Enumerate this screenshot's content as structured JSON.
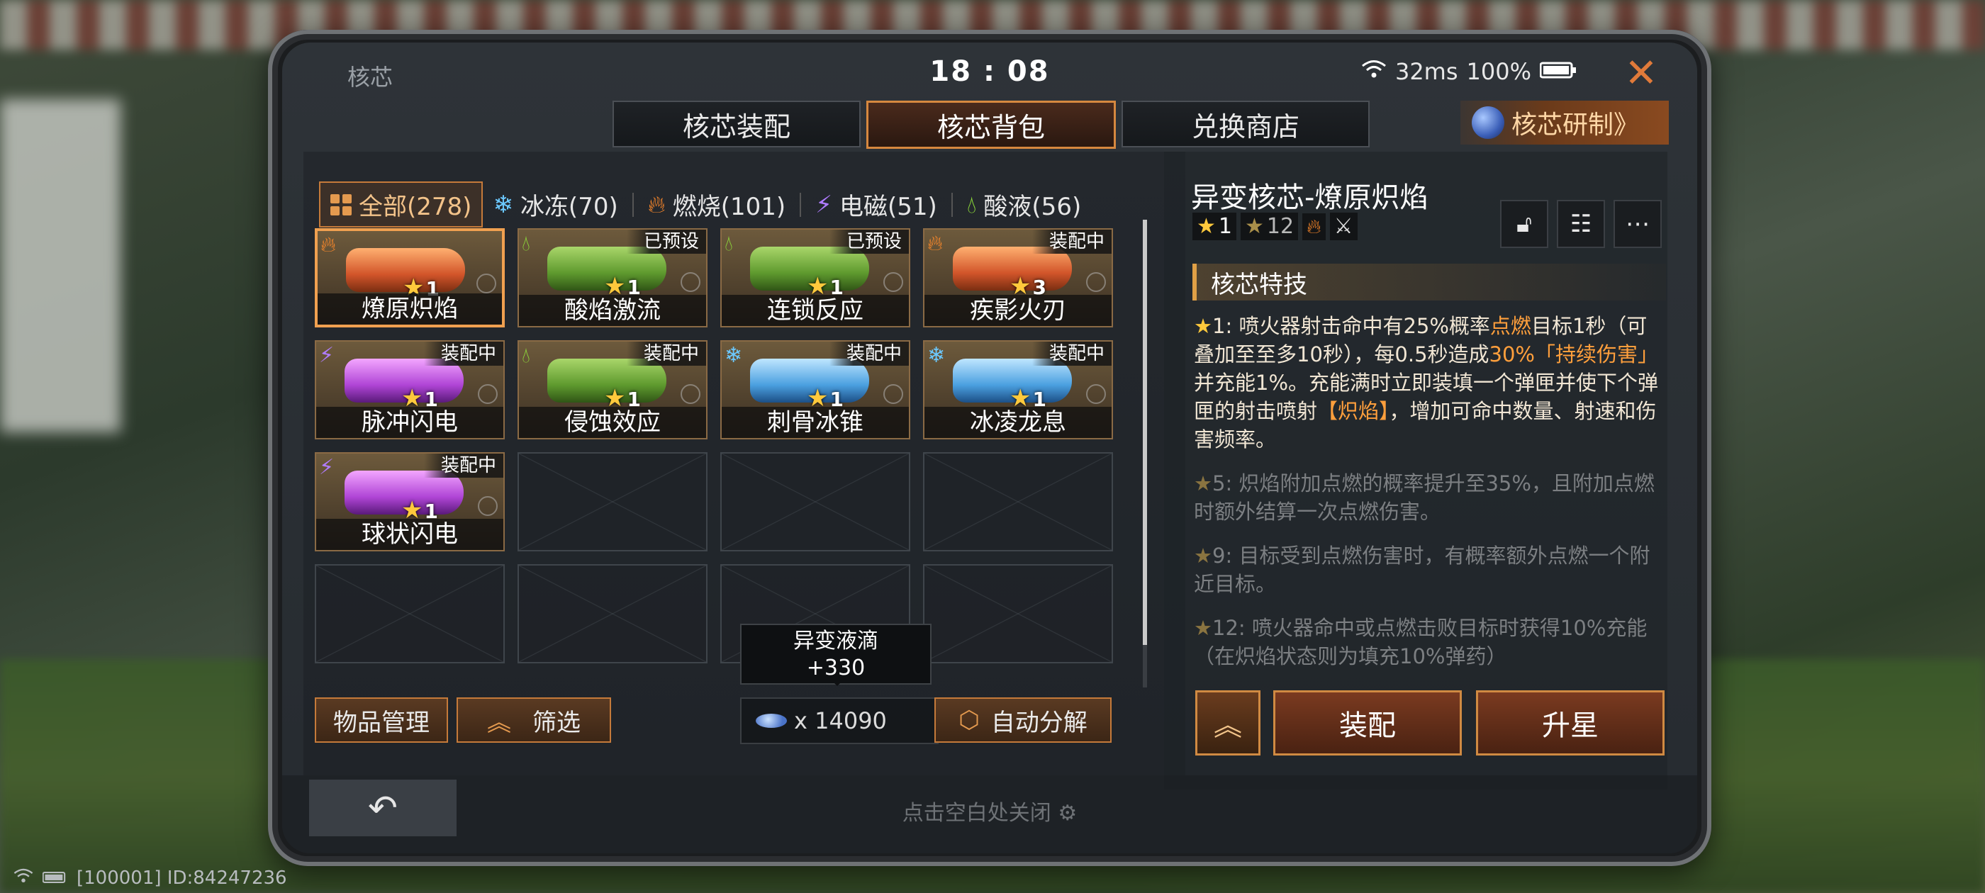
{
  "header": {
    "title": "核芯",
    "time": "18 : 08",
    "latency": "32ms",
    "battery": "100%"
  },
  "tabs": [
    {
      "label": "核芯装配",
      "active": false
    },
    {
      "label": "核芯背包",
      "active": true
    },
    {
      "label": "兑换商店",
      "active": false
    }
  ],
  "research_button": "核芯研制》",
  "filters": [
    {
      "label": "全部(278)",
      "icon": "grid-icon",
      "active": true
    },
    {
      "label": "冰冻(70)",
      "icon": "snowflake-icon",
      "active": false
    },
    {
      "label": "燃烧(101)",
      "icon": "flame-icon",
      "active": false
    },
    {
      "label": "电磁(51)",
      "icon": "lightning-icon",
      "active": false
    },
    {
      "label": "酸液(56)",
      "icon": "acid-drop-icon",
      "active": false
    }
  ],
  "items": [
    {
      "name": "燎原炽焰",
      "level": "1",
      "badge": "",
      "color": "orange",
      "element": "flame",
      "selected": true
    },
    {
      "name": "酸焰激流",
      "level": "1",
      "badge": "已预设",
      "color": "green",
      "element": "acid",
      "selected": false
    },
    {
      "name": "连锁反应",
      "level": "1",
      "badge": "已预设",
      "color": "green",
      "element": "acid",
      "selected": false
    },
    {
      "name": "疾影火刃",
      "level": "3",
      "badge": "装配中",
      "color": "orange",
      "element": "flame",
      "selected": false
    },
    {
      "name": "脉冲闪电",
      "level": "1",
      "badge": "装配中",
      "color": "purple",
      "element": "lightning",
      "selected": false
    },
    {
      "name": "侵蚀效应",
      "level": "1",
      "badge": "装配中",
      "color": "green",
      "element": "acid",
      "selected": false
    },
    {
      "name": "刺骨冰锥",
      "level": "1",
      "badge": "装配中",
      "color": "blue",
      "element": "ice",
      "selected": false
    },
    {
      "name": "冰凌龙息",
      "level": "1",
      "badge": "装配中",
      "color": "blue",
      "element": "ice",
      "selected": false
    },
    {
      "name": "球状闪电",
      "level": "1",
      "badge": "装配中",
      "color": "purple",
      "element": "lightning",
      "selected": false
    }
  ],
  "bottom_actions": {
    "manage": "物品管理",
    "filter": "筛选",
    "auto_decompose": "自动分解"
  },
  "tooltip": {
    "title": "异变液滴",
    "value": "+330"
  },
  "currency": {
    "label": "x 14090"
  },
  "detail": {
    "title": "异变核芯-燎原炽焰",
    "star_level": "1",
    "max_level": "12",
    "section_title": "核芯特技",
    "skills": [
      {
        "tier": "1:",
        "text": "喷火器射击命中有25%概率点燃目标1秒（可叠加至至多10秒），每0.5秒造成30%「持续伤害」并充能1%。充能满时立即装填一个弹匣并使下个弹匣的射击喷射【炽焰】，增加可命中数量、射速和伤害频率。",
        "active": true
      },
      {
        "tier": "5:",
        "text": "炽焰附加点燃的概率提升至35%，且附加点燃时额外结算一次点燃伤害。",
        "active": false
      },
      {
        "tier": "9:",
        "text": "目标受到点燃伤害时，有概率额外点燃一个附近目标。",
        "active": false
      },
      {
        "tier": "12:",
        "text": "喷火器命中或点燃击败目标时获得10%充能（在炽焰状态则为填充10%弹药）",
        "active": false
      }
    ],
    "equip": "装配",
    "upgrade": "升星"
  },
  "close_hint": "点击空白处关闭",
  "system_id": "[100001] ID:84247236",
  "colors": {
    "accent": "#d6883f",
    "star": "#ffc93c",
    "highlight": "#ff9f3c"
  }
}
